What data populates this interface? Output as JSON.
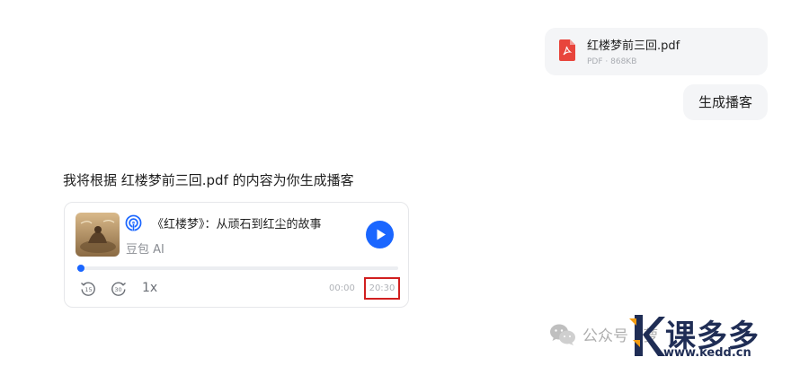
{
  "user_message": {
    "file": {
      "name": "红楼梦前三回.pdf",
      "meta": "PDF · 868KB",
      "icon": "pdf-icon"
    },
    "text": "生成播客"
  },
  "bot_message": {
    "text": "我将根据 红楼梦前三回.pdf 的内容为你生成播客"
  },
  "podcast": {
    "title": "《红楼梦》：从顽石到红尘的故事",
    "author": "豆包 AI",
    "progress": 0.01,
    "speed": "1x",
    "time_current": "00:00",
    "time_total": "20:30",
    "accent": "#1a66ff",
    "controls": [
      "rewind-15-icon",
      "forward-30-icon",
      "play-icon"
    ]
  },
  "watermark": {
    "text": "公众号 · 萝",
    "brand": "课多多",
    "url": "www.kedd.cn"
  }
}
